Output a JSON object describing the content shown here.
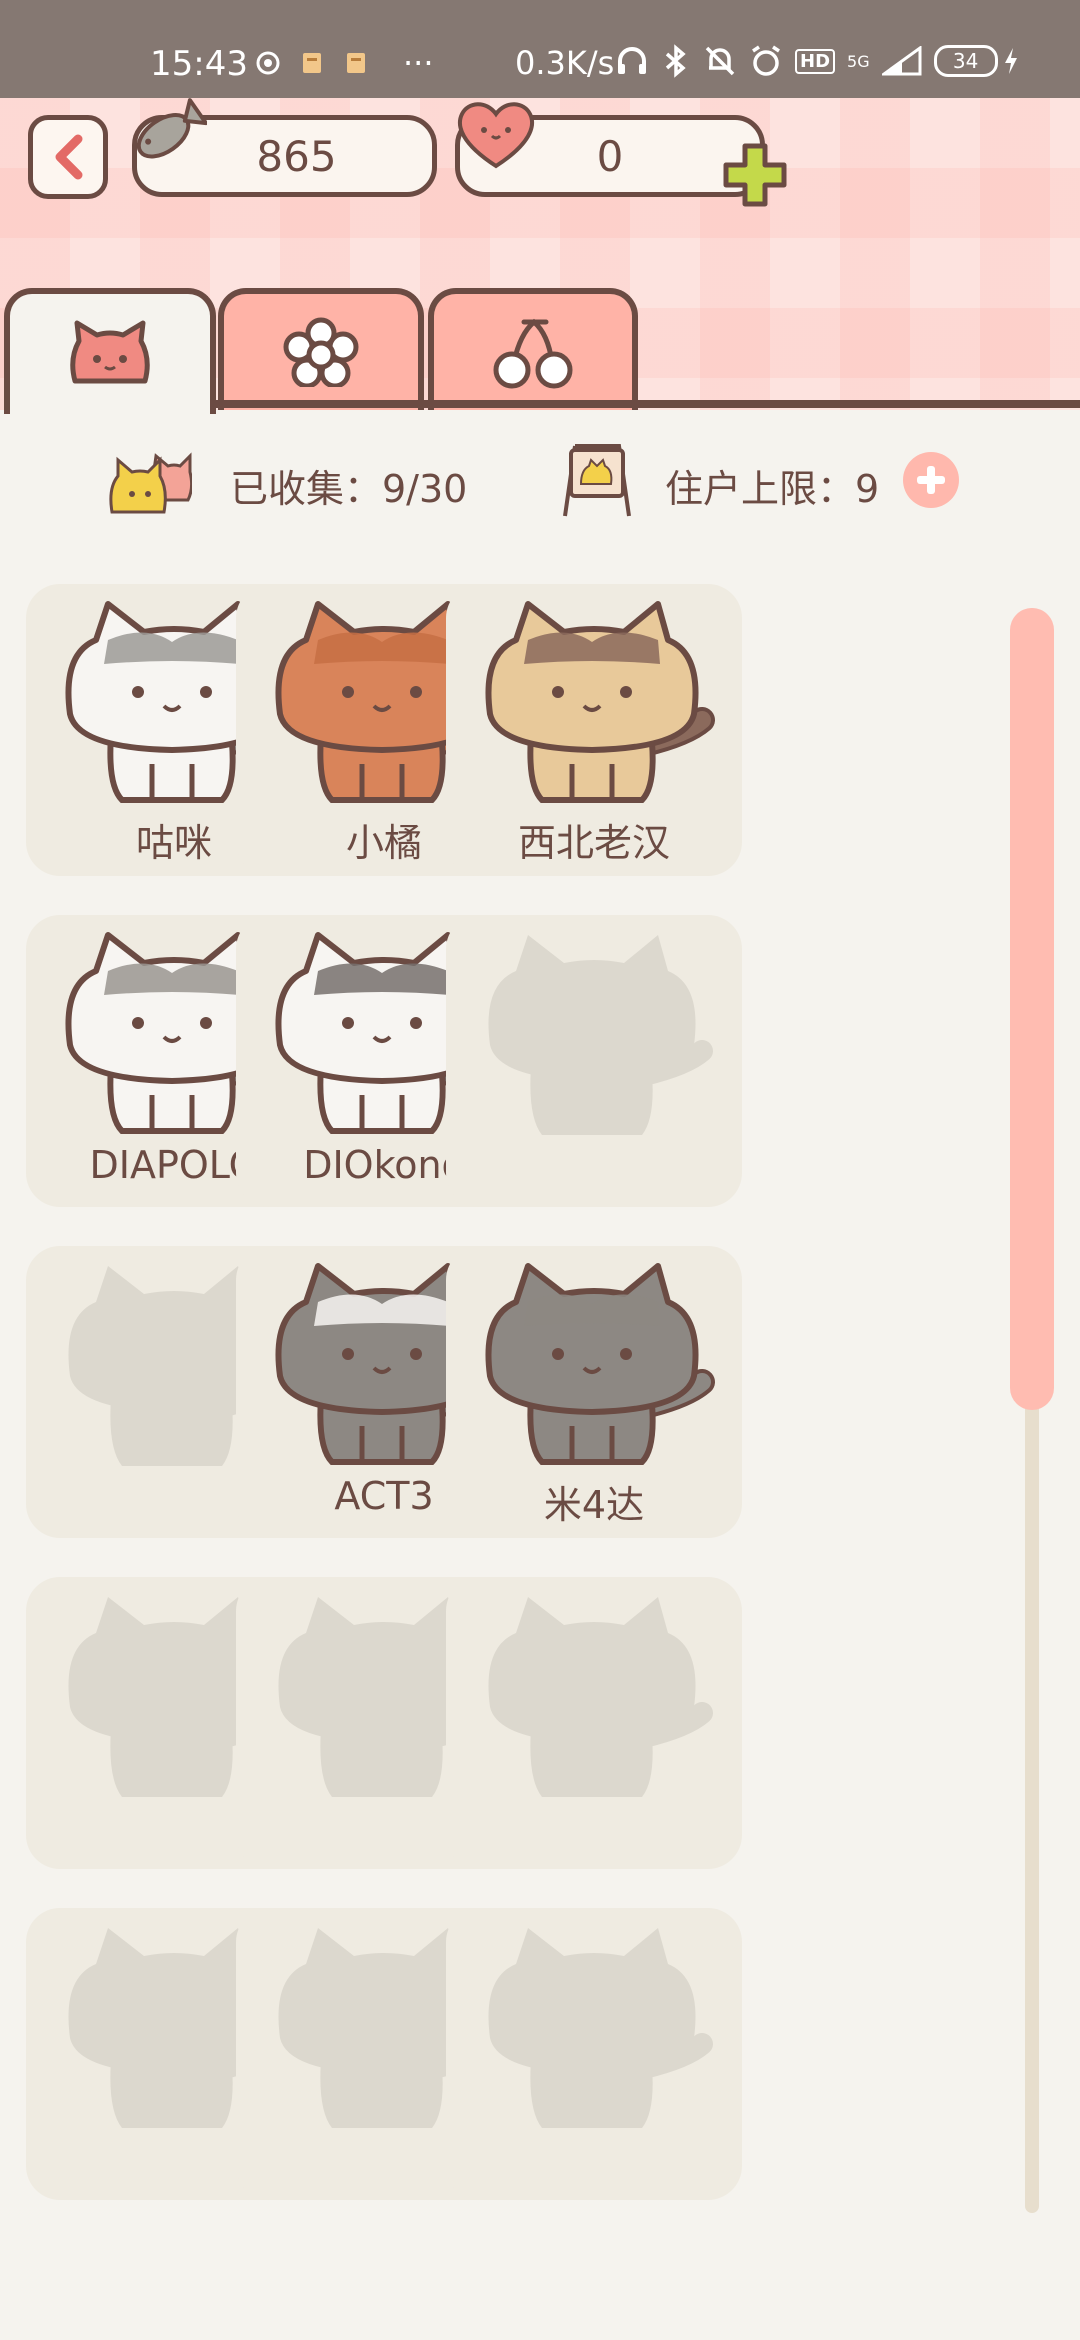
{
  "status_bar": {
    "time": "15:43",
    "dots": "···",
    "speed": "0.3K/s",
    "hd": "HD",
    "network": "5G",
    "battery": "34",
    "battery_level_percent": 34
  },
  "header": {
    "fish_count": "865",
    "heart_count": "0"
  },
  "tabs": [
    {
      "icon": "cat-face-icon",
      "active": true
    },
    {
      "icon": "flower-icon",
      "active": false
    },
    {
      "icon": "cherry-icon",
      "active": false
    }
  ],
  "stats": {
    "collected_label": "已收集：9/30",
    "limit_label": "住户上限：9"
  },
  "cats": [
    {
      "name": "咕咪",
      "unlocked": true,
      "fur": "#f7f5f2",
      "patch": "#9c9a96",
      "tail": "#9c9a96"
    },
    {
      "name": "小橘",
      "unlocked": true,
      "fur": "#d9845a",
      "patch": "#c66e44",
      "tail": "#d9845a"
    },
    {
      "name": "西北老汉",
      "unlocked": true,
      "fur": "#e8c99a",
      "patch": "#8b6a5c",
      "tail": "#8b6a5c"
    },
    {
      "name": "DIAPOLO",
      "unlocked": true,
      "fur": "#f7f5f2",
      "patch": "#9a9590",
      "tail": "#8d8883"
    },
    {
      "name": "DIOkono",
      "unlocked": true,
      "fur": "#f7f5f2",
      "patch": "#77706d",
      "tail": "#77706d"
    },
    {
      "name": "",
      "unlocked": false
    },
    {
      "name": "",
      "unlocked": false
    },
    {
      "name": "ACT3",
      "unlocked": true,
      "fur": "#8d8883",
      "patch": "#f7f5f2",
      "tail": "#8d8883"
    },
    {
      "name": "米4达",
      "unlocked": true,
      "fur": "#8d8883",
      "patch": "#8d8883",
      "tail": "#8d8883"
    },
    {
      "name": "",
      "unlocked": false
    },
    {
      "name": "",
      "unlocked": false
    },
    {
      "name": "",
      "unlocked": false
    },
    {
      "name": "",
      "unlocked": false
    },
    {
      "name": "",
      "unlocked": false
    },
    {
      "name": "",
      "unlocked": false
    }
  ],
  "colors": {
    "outline": "#6b4b43",
    "accent": "#ffb3a7",
    "plus": "#c4d94a",
    "silhouette": "#dcd8ce"
  }
}
